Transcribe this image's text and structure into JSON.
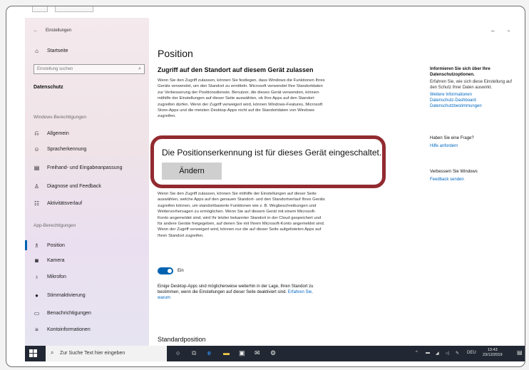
{
  "window": {
    "controls": {
      "minimize": "–",
      "maximize": "▫",
      "close": "✕"
    }
  },
  "sidebar": {
    "back": "←",
    "app_title": "Einstellungen",
    "home": "Startseite",
    "search_placeholder": "Einstellung suchen",
    "section": "Datenschutz",
    "group_windows": "Windows-Berechtigungen",
    "windows_items": [
      {
        "icon": "home-icon",
        "label": "Allgemein"
      },
      {
        "icon": "speech-icon",
        "label": "Spracherkennung"
      },
      {
        "icon": "pen-icon",
        "label": "Freihand- und Eingabeanpassung"
      },
      {
        "icon": "diagnose-icon",
        "label": "Diagnose und Feedback"
      },
      {
        "icon": "timeline-icon",
        "label": "Aktivitätsverlauf"
      }
    ],
    "group_app": "App-Berechtigungen",
    "app_items": [
      {
        "icon": "location-icon",
        "label": "Position",
        "active": true
      },
      {
        "icon": "camera-icon",
        "label": "Kamera"
      },
      {
        "icon": "microphone-icon",
        "label": "Mikrofon"
      },
      {
        "icon": "voice-icon",
        "label": "Stimmaktivierung"
      },
      {
        "icon": "notification-icon",
        "label": "Benachrichtigungen"
      },
      {
        "icon": "account-icon",
        "label": "Kontoinformationen"
      }
    ]
  },
  "main": {
    "title": "Position",
    "section_title": "Zugriff auf den Standort auf diesem Gerät zulassen",
    "intro": "Wenn Sie den Zugriff zulassen, können Sie festlegen, dass Windows die Funktionen Ihres Geräts verwendet, um den Standort zu ermitteln. Microsoft verwendet Ihre Standortdaten zur Verbesserung der Positionsdienste. Benutzer, die dieses Gerät verwenden, können mithilfe der Einstellungen auf dieser Seite auswählen, ob Ihre Apps auf den Standort zugreifen dürfen. Wenn der Zugriff verweigert wird, können Windows-Features, Microsoft Store-Apps und die meisten Desktop-Apps nicht auf die Standortdaten von Windows zugreifen.",
    "apps_text": "Wenn Sie den Zugriff zulassen, können Sie mithilfe der Einstellungen auf dieser Seite auswählen, welche Apps auf den genauen Standort- und den Standortverlauf Ihres Geräts zugreifen können, um standortbasierte Funktionen wie z. B. Wegbeschreibungen und Wettervorhersagen zu ermöglichen. Wenn Sie auf diesem Gerät mit einem Microsoft-Konto angemeldet sind, wird Ihr letzter bekannter Standort in der Cloud gespeichert und für andere Geräte freigegeben, auf denen Sie mit Ihrem Microsoft-Konto angemeldet sind. Wenn der Zugriff verweigert wird, können nur die auf dieser Seite aufgelisteten Apps auf Ihren Standort zugreifen.",
    "toggle_state": "Ein",
    "desktop_note": "Einige Desktop-Apps sind möglicherweise weiterhin in der Lage, Ihren Standort zu bestimmen, wenn die Einstellungen auf dieser Seite deaktiviert sind.",
    "desktop_note_link": "Erfahren Sie, warum",
    "next_section": "Standardposition"
  },
  "callout": {
    "text": "Die Positionserkennung ist für dieses Gerät eingeschaltet.",
    "button": "Ändern"
  },
  "right_panel": {
    "info_title": "Informieren Sie sich über Ihre Datenschutzoptionen.",
    "info_text": "Erfahren Sie, wie sich diese Einstellung auf den Schutz Ihrer Daten auswirkt.",
    "links": [
      "Weitere Informationen",
      "Datenschutz-Dashboard",
      "Datenschutzbestimmungen"
    ],
    "question_title": "Haben Sie eine Frage?",
    "question_link": "Hilfe anfordern",
    "improve_title": "Verbessern Sie Windows",
    "improve_link": "Feedback senden"
  },
  "taskbar": {
    "search_text": "Zur Suche Text hier eingeben",
    "language": "DEU",
    "time": "13:43",
    "date": "23/12/2019"
  },
  "colors": {
    "accent": "#0063b1",
    "callout_border": "#922b30",
    "link": "#0067c0"
  }
}
